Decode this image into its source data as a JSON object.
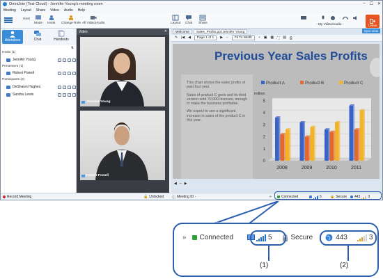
{
  "window": {
    "app": "OmniJoin (Test Cloud) - Jennifer Young's meeting room",
    "controls": [
      "–",
      "☐",
      "✕"
    ]
  },
  "menu": [
    "Meeting",
    "Layout",
    "Share",
    "Video",
    "Audio",
    "Help"
  ],
  "ribbon": {
    "host": "Host",
    "mode": "Mode",
    "invite": "Invite",
    "change_role": "Change Role",
    "all_video_audio": "All Video/Audio",
    "layout": "Layout",
    "chat": "Chat",
    "share": "Share",
    "my_video_audio": "- My Video/Audio -",
    "leave": "Leave"
  },
  "left_tabs": [
    "Attendees",
    "Chat",
    "Handouts"
  ],
  "attendees": {
    "groups": [
      {
        "label": "Hosts (1)",
        "members": [
          "Jennifer Young"
        ]
      },
      {
        "label": "Presenters (1)",
        "members": [
          "Robert Powell"
        ]
      },
      {
        "label": "Participants (2)",
        "members": [
          "DeShawn Hughes",
          "Sandra Lewis"
        ]
      }
    ]
  },
  "video": {
    "header": "Video",
    "tiles": [
      {
        "name": "Jennifer Young"
      },
      {
        "name": "Robert Powell"
      }
    ]
  },
  "doc": {
    "tabs": [
      "Welcome",
      "Sales_Profits.ppt:Jennifer Young"
    ],
    "sync": "Sync view",
    "page": "Page 1 of 1",
    "fit": "Fit To Width",
    "slide": {
      "title": "Previous Year Sales Profits",
      "p1": "This chart shows the sales profits of past four year.",
      "p2": "Sales of product C grew and its third version sold 70,000 licenses, enough to make the business profitable.",
      "p3": "We expect to see a significant increase in sales of the product C in this year."
    },
    "zoom": "–"
  },
  "chart_data": {
    "type": "bar",
    "ylabel": "million",
    "categories": [
      "2008",
      "2009",
      "2010",
      "2011"
    ],
    "ylim": [
      0,
      5
    ],
    "yticks": [
      0,
      1,
      2,
      3,
      4,
      5
    ],
    "legend_position": "top",
    "series": [
      {
        "name": "Product A",
        "color": "#3a63c8",
        "values": [
          3.6,
          3.2,
          2.6,
          4.6
        ]
      },
      {
        "name": "Product B",
        "color": "#e5672a",
        "values": [
          2.2,
          2.0,
          2.4,
          2.6
        ]
      },
      {
        "name": "Product C",
        "color": "#f3b328",
        "values": [
          2.6,
          2.8,
          3.2,
          4.2
        ]
      }
    ]
  },
  "status": {
    "record": "Record Meeting",
    "unlocked": "Unlocked",
    "meeting_id": "Meeting ID -",
    "connected": "Connected",
    "video_bars": "5",
    "secure": "Secure",
    "count": "443",
    "signal": "3"
  },
  "callout": {
    "expand": "»",
    "connected": "Connected",
    "video_bars": "5",
    "secure": "Secure",
    "count": "443",
    "signal": "3",
    "label1": "(1)",
    "label2": "(2)"
  }
}
